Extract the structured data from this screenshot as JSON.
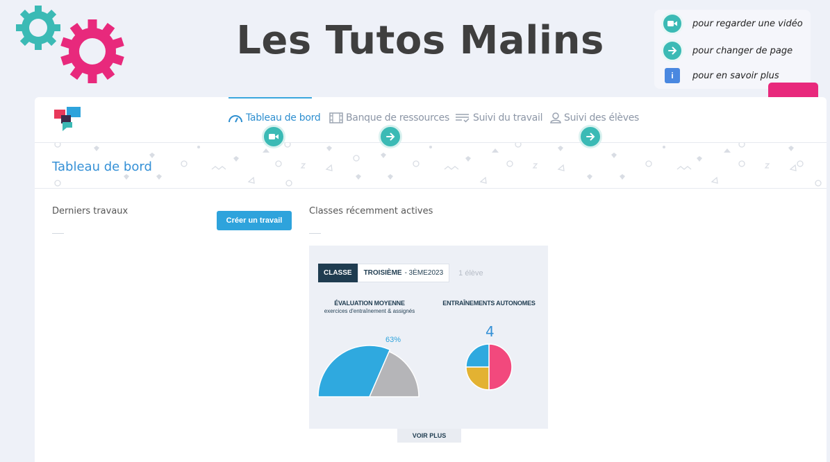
{
  "banner": {
    "title": "Les Tutos Malins"
  },
  "legend": {
    "items": [
      {
        "icon": "video-camera-icon",
        "label": "pour regarder une vidéo"
      },
      {
        "icon": "arrow-right-icon",
        "label": "pour changer de page"
      },
      {
        "icon": "info-icon",
        "label": "pour en savoir plus",
        "glyph": "i"
      }
    ]
  },
  "help_button": {
    "label": "?"
  },
  "nav": {
    "items": [
      {
        "label": "Tableau de bord",
        "icon": "gauge-icon",
        "active": true
      },
      {
        "label": "Banque de ressources",
        "icon": "film-icon",
        "active": false
      },
      {
        "label": "Suivi du travail",
        "icon": "list-check-icon",
        "active": false
      },
      {
        "label": "Suivi des élèves",
        "icon": "user-icon",
        "active": false
      }
    ]
  },
  "page": {
    "title": "Tableau de bord"
  },
  "left_col": {
    "label": "Derniers travaux",
    "create_button": "Créer un travail"
  },
  "right_col": {
    "label": "Classes récemment actives"
  },
  "class_card": {
    "tag": "CLASSE",
    "class_level": "TROISIÈME",
    "class_name": "- 3ÈME2023",
    "count": "1 élève",
    "eval_title": "ÉVALUATION MOYENNE",
    "eval_subtitle": "exercices d'entraînement & assignés",
    "eval_percent_label": "63%",
    "auto_title": "ENTRAÎNEMENTS AUTONOMES",
    "auto_count": "4",
    "more_button": "VOIR PLUS"
  },
  "colors": {
    "accent": "#2ea3dc",
    "teal": "#3bbab5",
    "pink": "#e8297c",
    "navy": "#1f3c50"
  },
  "chart_data": [
    {
      "type": "pie",
      "title": "ÉVALUATION MOYENNE",
      "subtitle": "exercices d'entraînement & assignés",
      "categories": [
        "",
        ""
      ],
      "values": [
        63,
        37
      ],
      "labels": [
        "63%",
        ""
      ],
      "colors": [
        "#2fa9df",
        "#b5b5b8"
      ],
      "style": "semicircle"
    },
    {
      "type": "pie",
      "title": "ENTRAÎNEMENTS AUTONOMES",
      "total_label": "4",
      "values": [
        2,
        1,
        1
      ],
      "colors": [
        "#f2497d",
        "#e3b232",
        "#2fa9df"
      ]
    }
  ]
}
